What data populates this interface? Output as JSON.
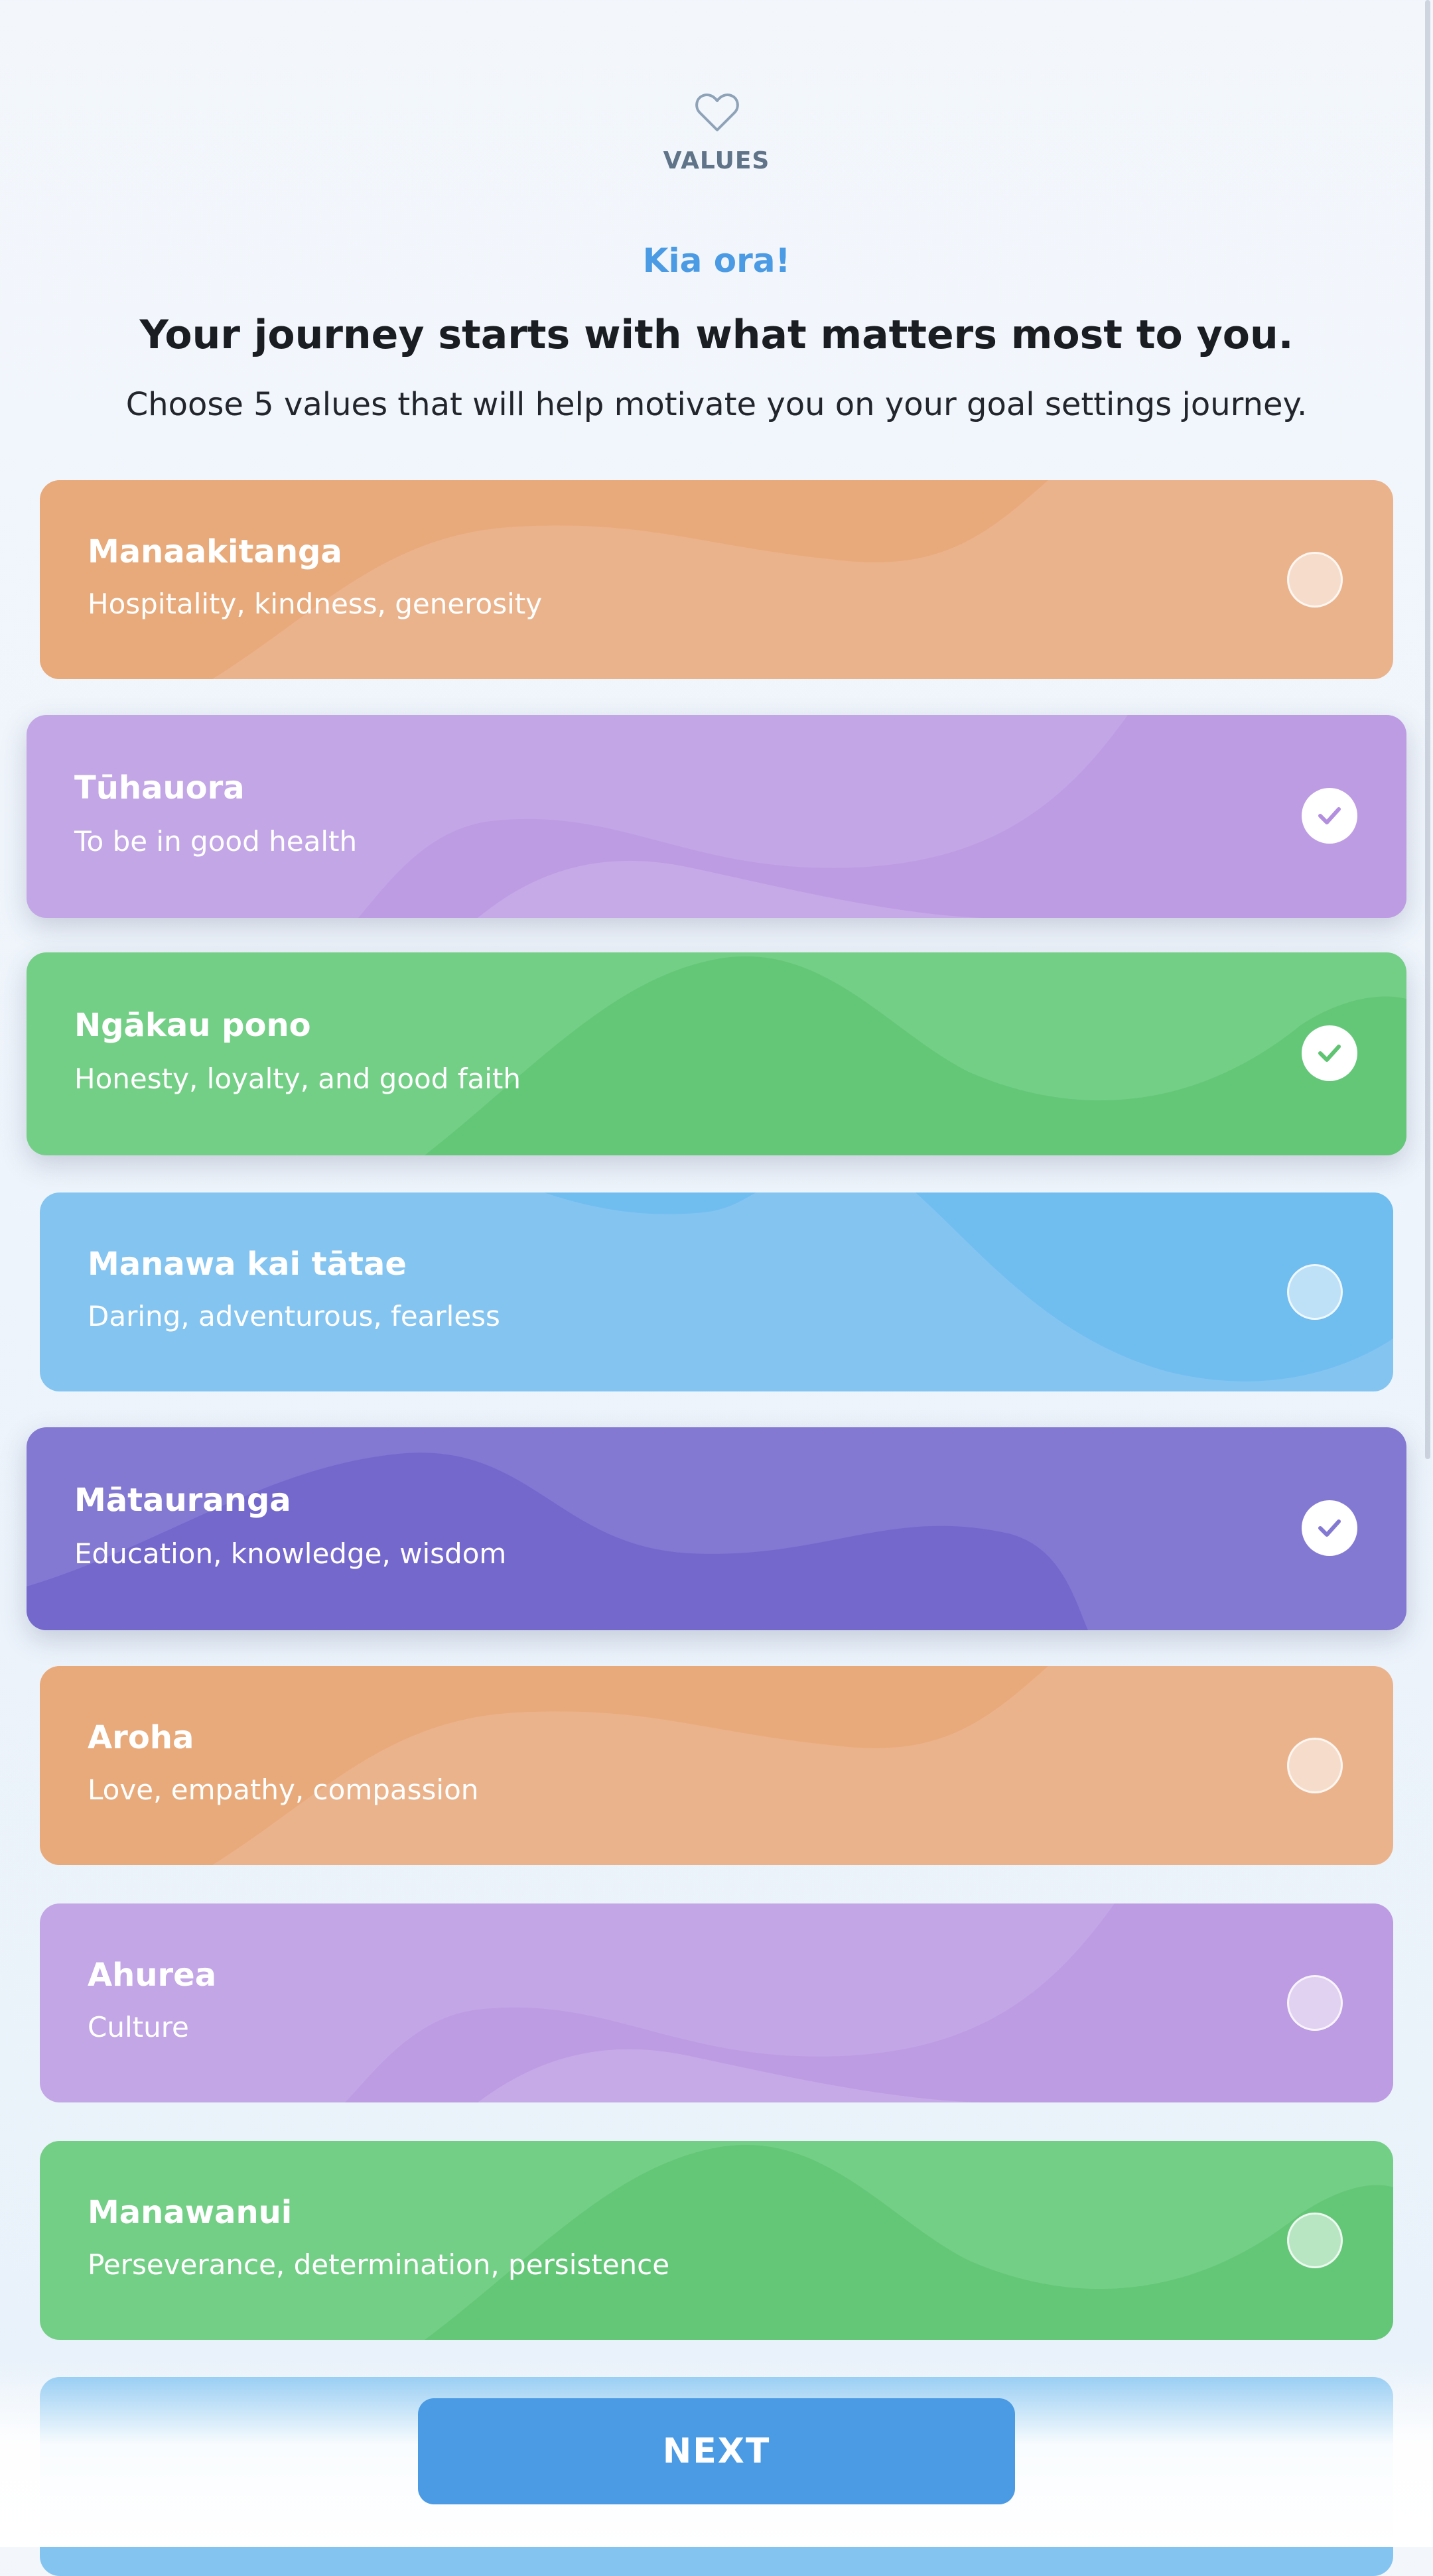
{
  "header": {
    "icon": "heart-icon",
    "section_label": "VALUES",
    "greeting": "Kia ora!",
    "headline": "Your journey starts with what matters most to you.",
    "subline": "Choose 5 values that will help motivate you on your goal settings journey."
  },
  "values": [
    {
      "title": "Manaakitanga",
      "description": "Hospitality, kindness, generosity",
      "selected": false,
      "color": "#ebb38c"
    },
    {
      "title": "Tūhauora",
      "description": "To be in good health",
      "selected": true,
      "color": "#c3a6e6"
    },
    {
      "title": "Ngākau pono",
      "description": "Honesty, loyalty, and good faith",
      "selected": true,
      "color": "#74cf86"
    },
    {
      "title": "Manawa kai tātae",
      "description": "Daring, adventurous, fearless",
      "selected": false,
      "color": "#84c4f1"
    },
    {
      "title": "Mātauranga",
      "description": "Education, knowledge, wisdom",
      "selected": true,
      "color": "#8379d2"
    },
    {
      "title": "Aroha",
      "description": "Love, empathy, compassion",
      "selected": false,
      "color": "#ebb38c"
    },
    {
      "title": "Ahurea",
      "description": "Culture",
      "selected": false,
      "color": "#c3a6e6"
    },
    {
      "title": "Manawanui",
      "description": "Perseverance, determination, persistence",
      "selected": false,
      "color": "#74cf86"
    }
  ],
  "partial_card": {
    "color": "#84c4f1"
  },
  "footer": {
    "next_label": "NEXT",
    "accent": "#4a9ae4"
  }
}
